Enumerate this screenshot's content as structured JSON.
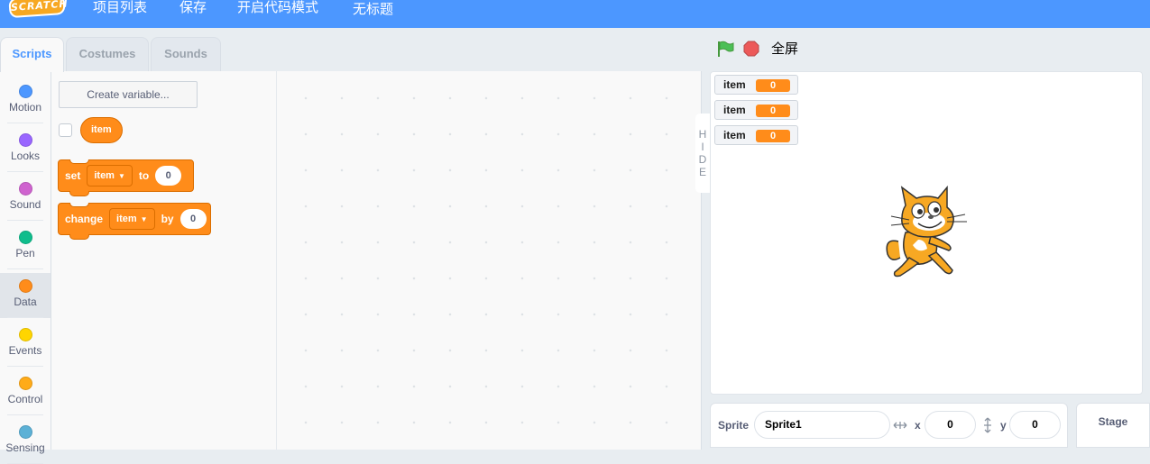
{
  "menubar": {
    "logo": "SCRATCH",
    "items": [
      "项目列表",
      "保存",
      "开启代码模式",
      "无标题"
    ]
  },
  "tabs": [
    {
      "label": "Scripts",
      "active": true
    },
    {
      "label": "Costumes",
      "active": false
    },
    {
      "label": "Sounds",
      "active": false
    }
  ],
  "categories": [
    {
      "label": "Motion",
      "color": "#4c97ff"
    },
    {
      "label": "Looks",
      "color": "#9966ff"
    },
    {
      "label": "Sound",
      "color": "#cf63cf"
    },
    {
      "label": "Pen",
      "color": "#0fbd8c"
    },
    {
      "label": "Data",
      "color": "#ff8c1a",
      "active": true
    },
    {
      "label": "Events",
      "color": "#ffd500"
    },
    {
      "label": "Control",
      "color": "#ffab19"
    },
    {
      "label": "Sensing",
      "color": "#5cb1d6"
    }
  ],
  "palette": {
    "create_variable": "Create variable...",
    "variable_reporter": "item",
    "set_block": {
      "verb": "set",
      "var": "item",
      "to": "to",
      "value": "0"
    },
    "change_block": {
      "verb": "change",
      "var": "item",
      "by": "by",
      "value": "0"
    }
  },
  "hide_tab": [
    "H",
    "I",
    "D",
    "E"
  ],
  "stage_header": {
    "fullscreen": "全屏"
  },
  "monitors": [
    {
      "label": "item",
      "value": "0"
    },
    {
      "label": "item",
      "value": "0"
    },
    {
      "label": "item",
      "value": "0"
    }
  ],
  "sprite_info": {
    "label": "Sprite",
    "name": "Sprite1",
    "x_label": "x",
    "x": "0",
    "y_label": "y",
    "y": "0"
  },
  "stage_pane": {
    "label": "Stage"
  },
  "colors": {
    "menubar": "#4c97ff",
    "data": "#ff8c1a",
    "green_flag": "#4cbf56",
    "stop": "#ec5959"
  }
}
